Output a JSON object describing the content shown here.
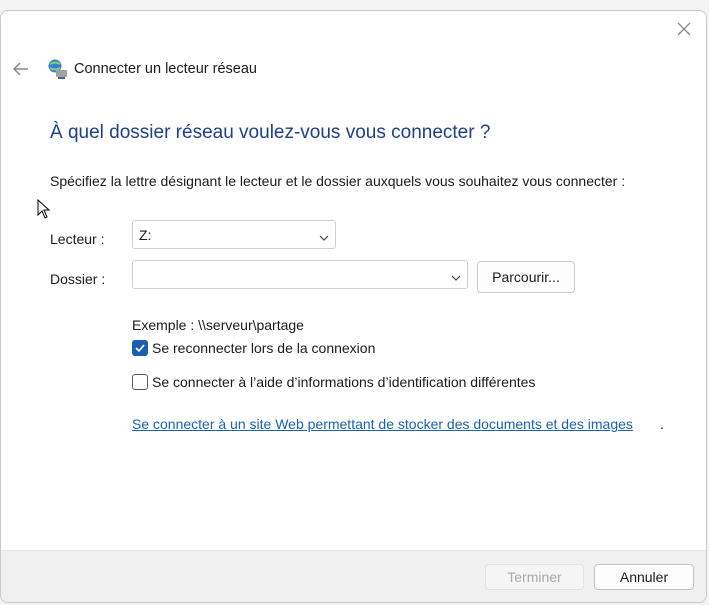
{
  "window": {
    "title": "Connecter un lecteur réseau"
  },
  "main": {
    "heading": "À quel dossier réseau voulez-vous vous connecter ?",
    "instruction": "Spécifiez la lettre désignant le lecteur et le dossier auxquels vous souhaitez vous connecter :",
    "drive_label": "Lecteur :",
    "drive_value": "Z:",
    "folder_label": "Dossier :",
    "folder_value": "",
    "browse_label": "Parcourir...",
    "example": "Exemple : \\\\serveur\\partage",
    "reconnect_label": "Se reconnecter lors de la connexion",
    "reconnect_checked": true,
    "other_credentials_label": "Se connecter à l’aide d’informations d’identification différentes",
    "other_credentials_checked": false,
    "link_text": "Se connecter à un site Web permettant de stocker des documents et des images",
    "link_suffix": "."
  },
  "footer": {
    "finish_label": "Terminer",
    "cancel_label": "Annuler"
  },
  "colors": {
    "heading": "#1e3f8a",
    "link": "#1a63b0",
    "checkbox_accent": "#1a5fb4"
  },
  "icons": {
    "close": "close-icon",
    "back": "back-arrow-icon",
    "app": "network-drive-icon",
    "dropdown": "chevron-down-icon",
    "checkmark": "checkmark-icon"
  }
}
